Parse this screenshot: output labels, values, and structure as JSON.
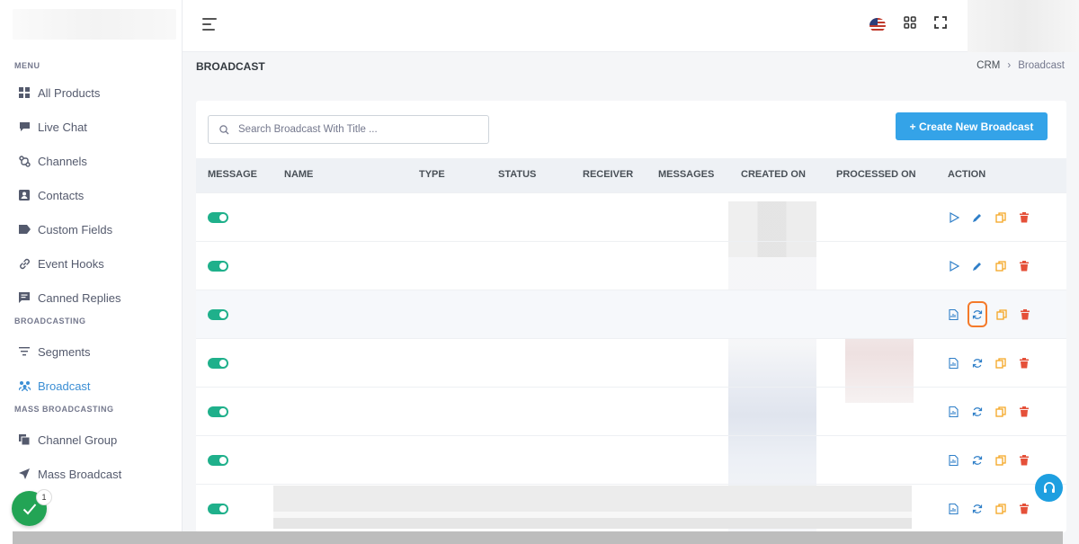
{
  "sidebar": {
    "sections": [
      {
        "title": "MENU",
        "items": [
          {
            "label": "All Products",
            "icon": "grid-icon"
          },
          {
            "label": "Live Chat",
            "icon": "chat-icon"
          },
          {
            "label": "Channels",
            "icon": "channels-icon"
          },
          {
            "label": "Contacts",
            "icon": "contact-card-icon"
          },
          {
            "label": "Custom Fields",
            "icon": "tag-icon"
          },
          {
            "label": "Event Hooks",
            "icon": "link-icon"
          },
          {
            "label": "Canned Replies",
            "icon": "message-square-icon"
          }
        ]
      },
      {
        "title": "BROADCASTING",
        "items": [
          {
            "label": "Segments",
            "icon": "filter-icon"
          },
          {
            "label": "Broadcast",
            "icon": "broadcast-icon",
            "active": true
          }
        ]
      },
      {
        "title": "MASS BROADCASTING",
        "items": [
          {
            "label": "Channel Group",
            "icon": "copy-icon"
          },
          {
            "label": "Mass Broadcast",
            "icon": "send-icon"
          }
        ]
      }
    ]
  },
  "header": {
    "page_title": "BROADCAST",
    "breadcrumb": {
      "parent": "CRM",
      "current": "Broadcast"
    }
  },
  "toolbar": {
    "search_placeholder": "Search Broadcast With Title ...",
    "create_label": "+ Create New Broadcast"
  },
  "table": {
    "columns": [
      "MESSAGE",
      "NAME",
      "TYPE",
      "STATUS",
      "RECEIVER",
      "MESSAGES",
      "CREATED ON",
      "PROCESSED ON",
      "ACTION"
    ],
    "rows": [
      {
        "enabled": true,
        "actions": [
          "play-icon",
          "edit-icon",
          "copy-icon",
          "trash-icon"
        ]
      },
      {
        "enabled": true,
        "actions": [
          "play-icon",
          "edit-icon",
          "copy-icon",
          "trash-icon"
        ]
      },
      {
        "enabled": true,
        "actions": [
          "report-icon",
          "refresh-icon",
          "copy-icon",
          "trash-icon"
        ],
        "highlighted_action": 1
      },
      {
        "enabled": true,
        "actions": [
          "report-icon",
          "refresh-icon",
          "copy-icon",
          "trash-icon"
        ]
      },
      {
        "enabled": true,
        "actions": [
          "report-icon",
          "refresh-icon",
          "copy-icon",
          "trash-icon"
        ]
      },
      {
        "enabled": true,
        "actions": [
          "report-icon",
          "refresh-icon",
          "copy-icon",
          "trash-icon"
        ]
      },
      {
        "enabled": true,
        "actions": [
          "report-icon",
          "refresh-icon",
          "copy-icon",
          "trash-icon"
        ]
      }
    ]
  },
  "widgets": {
    "notification_count": "1"
  },
  "colors": {
    "accent": "#34a3e8",
    "toggle_on": "#1fb08b",
    "edit": "#2f7fc8",
    "copy": "#f5a623",
    "delete": "#e55039",
    "highlight": "#f47a2a"
  }
}
